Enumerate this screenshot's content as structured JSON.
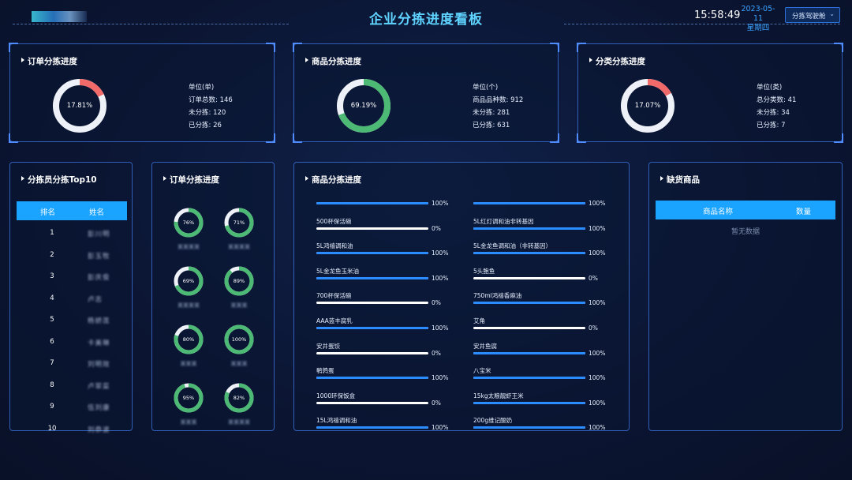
{
  "header": {
    "title": "企业分拣进度看板",
    "time": "15:58:49",
    "date": "2023-05-11",
    "weekday": "星期四",
    "dropdown_value": "分拣驾驶舱",
    "dropdown_icon": "chevron-down-icon",
    "accent": "#5fd3ff"
  },
  "summary": [
    {
      "title": "订单分拣进度",
      "percent_label": "17.81%",
      "percent": 17.81,
      "unit": "单位(单)",
      "total": "订单总数: 146",
      "pending": "未分拣: 120",
      "done": "已分拣: 26",
      "color": "#f06a6a"
    },
    {
      "title": "商品分拣进度",
      "percent_label": "69.19%",
      "percent": 69.19,
      "unit": "单位(个)",
      "total": "商品品种数: 912",
      "pending": "未分拣: 281",
      "done": "已分拣: 631",
      "color": "#4cba74"
    },
    {
      "title": "分类分拣进度",
      "percent_label": "17.07%",
      "percent": 17.07,
      "unit": "单位(类)",
      "total": "总分类数: 41",
      "pending": "未分拣: 34",
      "done": "已分拣: 7",
      "color": "#f06a6a"
    }
  ],
  "top10": {
    "title": "分拣员分拣Top10",
    "col_rank": "排名",
    "col_name": "姓名",
    "rows": [
      {
        "rank": "1",
        "name": "彭川明"
      },
      {
        "rank": "2",
        "name": "彭玉牧"
      },
      {
        "rank": "3",
        "name": "彭庆俊"
      },
      {
        "rank": "4",
        "name": "卢志"
      },
      {
        "rank": "5",
        "name": "杨娇莲"
      },
      {
        "rank": "6",
        "name": "卡美琳"
      },
      {
        "rank": "7",
        "name": "刘明效"
      },
      {
        "rank": "8",
        "name": "卢翠菜"
      },
      {
        "rank": "9",
        "name": "伍刘康"
      },
      {
        "rank": "10",
        "name": "刘恭波"
      }
    ]
  },
  "order_rings": {
    "title": "订单分拣进度",
    "items": [
      {
        "label": "76%",
        "percent": 76,
        "name": "某某某某"
      },
      {
        "label": "71%",
        "percent": 71,
        "name": "某某某某"
      },
      {
        "label": "69%",
        "percent": 69,
        "name": "某某某某"
      },
      {
        "label": "89%",
        "percent": 89,
        "name": "某某某"
      },
      {
        "label": "80%",
        "percent": 80,
        "name": "某某某"
      },
      {
        "label": "100%",
        "percent": 100,
        "name": "某某某"
      },
      {
        "label": "95%",
        "percent": 95,
        "name": "某某某"
      },
      {
        "label": "82%",
        "percent": 82,
        "name": "某某某某"
      }
    ]
  },
  "product_bars": {
    "title": "商品分拣进度",
    "left": [
      {
        "name": "",
        "percent": 100,
        "label": "100%"
      },
      {
        "name": "500杯保活碗",
        "percent": 0,
        "label": "0%"
      },
      {
        "name": "5L鸿禧调和油",
        "percent": 100,
        "label": "100%"
      },
      {
        "name": "5L金龙鱼玉米油",
        "percent": 100,
        "label": "100%"
      },
      {
        "name": "700杯保活碗",
        "percent": 0,
        "label": "0%"
      },
      {
        "name": "AAA蓝丰腐乳",
        "percent": 100,
        "label": "100%"
      },
      {
        "name": "安井蛋饺",
        "percent": 0,
        "label": "0%"
      },
      {
        "name": "鹌鹑蛋",
        "percent": 100,
        "label": "100%"
      },
      {
        "name": "1000环保饭盒",
        "percent": 0,
        "label": "0%"
      },
      {
        "name": "15L鸿禧调和油",
        "percent": 100,
        "label": "100%"
      }
    ],
    "right": [
      {
        "name": "",
        "percent": 100,
        "label": "100%"
      },
      {
        "name": "5L红灯调和油非转基因",
        "percent": 100,
        "label": "100%"
      },
      {
        "name": "5L金龙鱼调和油（非转基因）",
        "percent": 100,
        "label": "100%"
      },
      {
        "name": "5头鲍鱼",
        "percent": 0,
        "label": "0%"
      },
      {
        "name": "750ml鸿禧香麻油",
        "percent": 100,
        "label": "100%"
      },
      {
        "name": "艾角",
        "percent": 0,
        "label": "0%"
      },
      {
        "name": "安井鱼腐",
        "percent": 100,
        "label": "100%"
      },
      {
        "name": "八宝米",
        "percent": 100,
        "label": "100%"
      },
      {
        "name": "15kg太粮靓虾王米",
        "percent": 100,
        "label": "100%"
      },
      {
        "name": "200g维记酸奶",
        "percent": 100,
        "label": "100%"
      }
    ]
  },
  "shortage": {
    "title": "缺货商品",
    "col_name": "商品名称",
    "col_qty": "数量",
    "empty": "暂无数据"
  },
  "colors": {
    "panel_border": "#2f5fb8",
    "bar_fill": "#2a8cff",
    "ring_green": "#4cba74",
    "ring_red": "#f06a6a",
    "header_blue": "#1aa3ff"
  }
}
